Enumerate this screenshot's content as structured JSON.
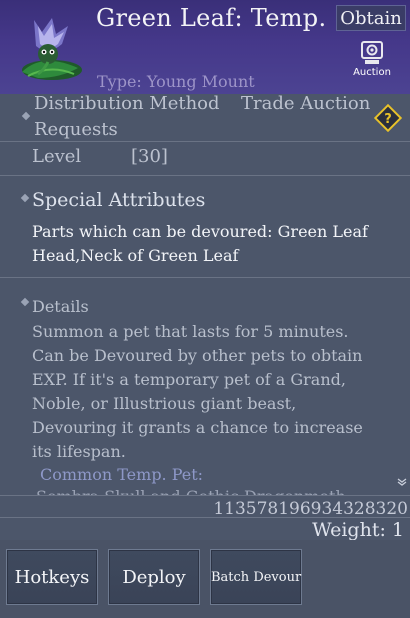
{
  "header": {
    "title": "Green Leaf: Temp.",
    "obtain_label": "Obtain",
    "auction_label": "Auction",
    "type_line": "Type: Young Mount"
  },
  "info": {
    "distribution_label": "Distribution Method",
    "distribution_value": "Trade Auction",
    "requests_label": "Requests",
    "level_label": "Level",
    "level_value": "[30]"
  },
  "special": {
    "title": "Special Attributes",
    "line1": "Parts which can be devoured: Green Leaf",
    "line2": "Head,Neck of Green Leaf"
  },
  "details": {
    "title": "Details",
    "lines": [
      "Summon a pet that lasts for 5 minutes.",
      "Can be Devoured by other pets to obtain",
      "EXP. If it's a temporary pet of a Grand,",
      "Noble, or Illustrious giant beast,",
      "Devouring it grants a chance to increase",
      "its lifespan."
    ],
    "common_label": "Common Temp. Pet:",
    "cutoff_line": "Sombra Skull and Gothic Dragonmoth..."
  },
  "footer": {
    "item_number": "113578196934328320",
    "weight": "Weight: 1"
  },
  "buttons": {
    "hotkeys": "Hotkeys",
    "deploy": "Deploy",
    "batch_devour": "Batch Devour"
  },
  "icons": {
    "pet": "green-leaf-pet-icon",
    "auction": "auction-icon",
    "help": "help-diamond-icon",
    "scroll": "scroll-down-icon"
  },
  "colors": {
    "header_bg": "#3e3282",
    "body_bg": "#4c566a",
    "button_bg": "#3d475b",
    "help_icon": "#e8c22a",
    "common_label": "#8e98c8"
  }
}
